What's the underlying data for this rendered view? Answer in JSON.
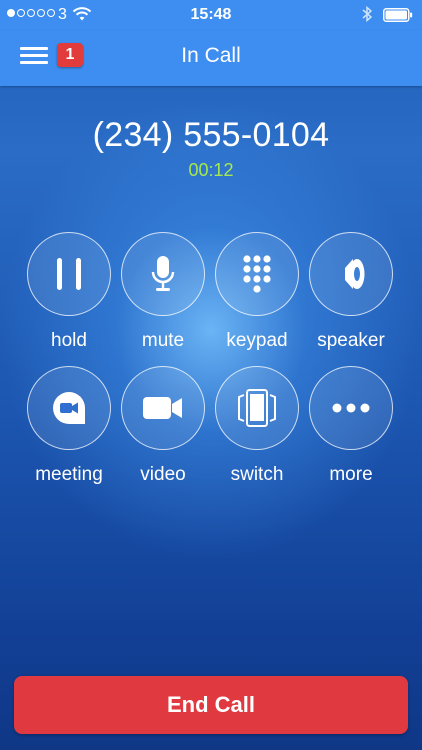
{
  "status_bar": {
    "carrier": "3",
    "time": "15:48",
    "signal_bars_filled": 1,
    "signal_bars_total": 5
  },
  "nav": {
    "title": "In Call",
    "badge_count": "1"
  },
  "call": {
    "number": "(234) 555-0104",
    "duration": "00:12"
  },
  "controls": [
    {
      "label": "hold",
      "icon": "pause-icon"
    },
    {
      "label": "mute",
      "icon": "microphone-icon"
    },
    {
      "label": "keypad",
      "icon": "keypad-icon"
    },
    {
      "label": "speaker",
      "icon": "speaker-icon"
    },
    {
      "label": "meeting",
      "icon": "meeting-icon"
    },
    {
      "label": "video",
      "icon": "video-camera-icon"
    },
    {
      "label": "switch",
      "icon": "switch-device-icon"
    },
    {
      "label": "more",
      "icon": "more-dots-icon"
    }
  ],
  "end_call": {
    "label": "End Call"
  },
  "colors": {
    "nav_background": "#3d8ef0",
    "end_call": "#e03a40",
    "timer": "#a5e84d",
    "badge": "#e23b3b"
  }
}
